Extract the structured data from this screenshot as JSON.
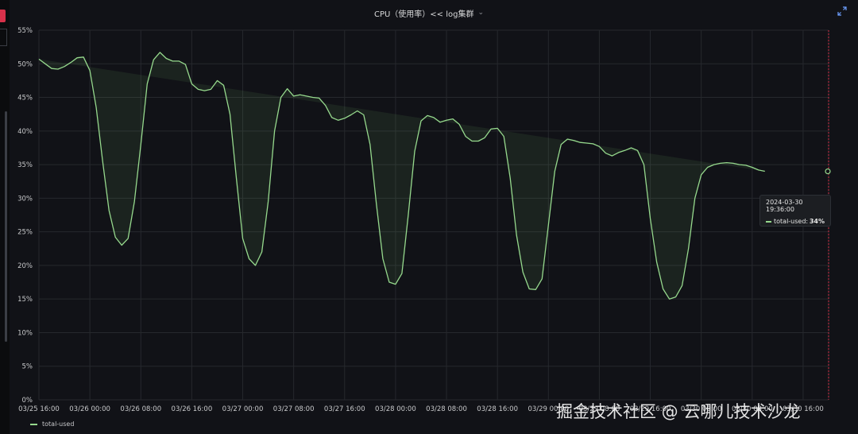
{
  "panel": {
    "title": "CPU（使用率）<< log集群",
    "expand_icon": "expand-icon",
    "chevron_icon": "chevron-down-icon"
  },
  "colors": {
    "background": "#111217",
    "series": "#96d98d",
    "fill": "rgba(115,191,105,0.10)",
    "grid": "#26282d",
    "now_marker": "#d8314a",
    "axis_text": "#c7c8ca"
  },
  "tooltip": {
    "time": "2024-03-30 19:36:00",
    "series": "total-used:",
    "value": "34%"
  },
  "legend": {
    "label": "total-used"
  },
  "watermark": "掘金技术社区 @ 云哪儿技术沙龙",
  "chart_data": {
    "type": "area",
    "title": "CPU（使用率）<< log集群",
    "y_unit": "%",
    "ylim": [
      0,
      55
    ],
    "y_ticks": [
      "0%",
      "5%",
      "10%",
      "15%",
      "20%",
      "25%",
      "30%",
      "35%",
      "40%",
      "45%",
      "50%",
      "55%"
    ],
    "x_ticks": [
      "03/25 16:00",
      "03/26 00:00",
      "03/26 08:00",
      "03/26 16:00",
      "03/27 00:00",
      "03/27 08:00",
      "03/27 16:00",
      "03/28 00:00",
      "03/28 08:00",
      "03/28 16:00",
      "03/29 00:00",
      "03/29 08:00",
      "03/29 16:00",
      "03/30 00:00",
      "03/30 08:00",
      "03/30 16:00"
    ],
    "grid": true,
    "legend_position": "bottom-left",
    "series": [
      {
        "name": "total-used",
        "x_hours": [
          0,
          1,
          2,
          3,
          4,
          5,
          6,
          7,
          8,
          9,
          10,
          11,
          12,
          13,
          14,
          15,
          16,
          17,
          18,
          19,
          20,
          21,
          22,
          23,
          24,
          25,
          26,
          27,
          28,
          29,
          30,
          31,
          32,
          33,
          34,
          35,
          36,
          37,
          38,
          39,
          40,
          41,
          42,
          43,
          44,
          45,
          46,
          47,
          48,
          49,
          50,
          51,
          52,
          53,
          54,
          55,
          56,
          57,
          58,
          59,
          60,
          61,
          62,
          63,
          64,
          65,
          66,
          67,
          68,
          69,
          70,
          71,
          72,
          73,
          74,
          75,
          76,
          77,
          78,
          79,
          80,
          81,
          82,
          83,
          84,
          85,
          86,
          87,
          88,
          89,
          90,
          91,
          92,
          93,
          94,
          95,
          96,
          97,
          98,
          99,
          100,
          101,
          102,
          103,
          104,
          105,
          106,
          107,
          108,
          109,
          110,
          111,
          112,
          113,
          114,
          115,
          116,
          117,
          118,
          119,
          120,
          121,
          122,
          123,
          124
        ],
        "values": [
          50.7,
          50.0,
          49.3,
          49.2,
          49.6,
          50.2,
          50.9,
          51.0,
          49.0,
          43.5,
          35.5,
          28.2,
          24.2,
          23.0,
          24.0,
          29.5,
          38.0,
          47.0,
          50.6,
          51.7,
          50.8,
          50.4,
          50.4,
          49.9,
          47.0,
          46.2,
          46.0,
          46.2,
          47.5,
          46.8,
          42.5,
          33.0,
          24.0,
          21.0,
          20.0,
          22.0,
          29.5,
          40.0,
          45.0,
          46.3,
          45.2,
          45.4,
          45.2,
          45.0,
          44.9,
          43.8,
          42.0,
          41.6,
          41.9,
          42.4,
          43.0,
          42.4,
          38.0,
          29.0,
          21.0,
          17.5,
          17.2,
          18.8,
          27.5,
          37.0,
          41.5,
          42.3,
          42.0,
          41.3,
          41.6,
          41.8,
          41.0,
          39.2,
          38.5,
          38.5,
          39.0,
          40.3,
          40.4,
          39.2,
          33.0,
          24.5,
          19.0,
          16.5,
          16.4,
          18.0,
          26.0,
          34.0,
          38.0,
          38.8,
          38.6,
          38.3,
          38.2,
          38.1,
          37.7,
          36.7,
          36.3,
          36.8,
          37.1,
          37.5,
          37.1,
          35.0,
          27.0,
          20.5,
          16.5,
          15.0,
          15.3,
          17.0,
          22.5,
          30.0,
          33.5,
          34.6,
          35.0,
          35.2,
          35.3,
          35.2,
          35.0,
          34.9,
          34.6,
          34.2,
          34.0
        ]
      }
    ]
  }
}
